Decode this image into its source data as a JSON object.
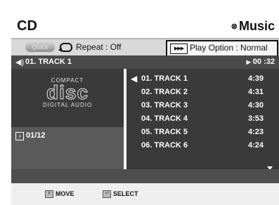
{
  "header": {
    "title": "CD",
    "mode_icon": "music-mode-icon",
    "mode_label": "Music"
  },
  "controls": {
    "quick_label": "Quick",
    "repeat_label": "Repeat : Off",
    "play_option_icon": "play-option-icon",
    "play_option_label": "Play Option : Normal"
  },
  "now_playing": {
    "track": "01. TRACK 1",
    "elapsed": "00 :32"
  },
  "disc": {
    "logo_top": "COMPACT",
    "logo_main": "disc",
    "logo_bottom": "DIGITAL AUDIO"
  },
  "info": {
    "counter": "01/12"
  },
  "tracks": [
    {
      "name": "01. TRACK 1",
      "duration": "4:39",
      "playing": true
    },
    {
      "name": "02. TRACK 2",
      "duration": "4:31",
      "playing": false
    },
    {
      "name": "03. TRACK 3",
      "duration": "4:30",
      "playing": false
    },
    {
      "name": "04. TRACK 4",
      "duration": "3:53",
      "playing": false
    },
    {
      "name": "05. TRACK 5",
      "duration": "4:23",
      "playing": false
    },
    {
      "name": "06. TRACK 6",
      "duration": "4:24",
      "playing": false
    }
  ],
  "footer": {
    "move_label": "MOVE",
    "select_label": "SELECT"
  }
}
